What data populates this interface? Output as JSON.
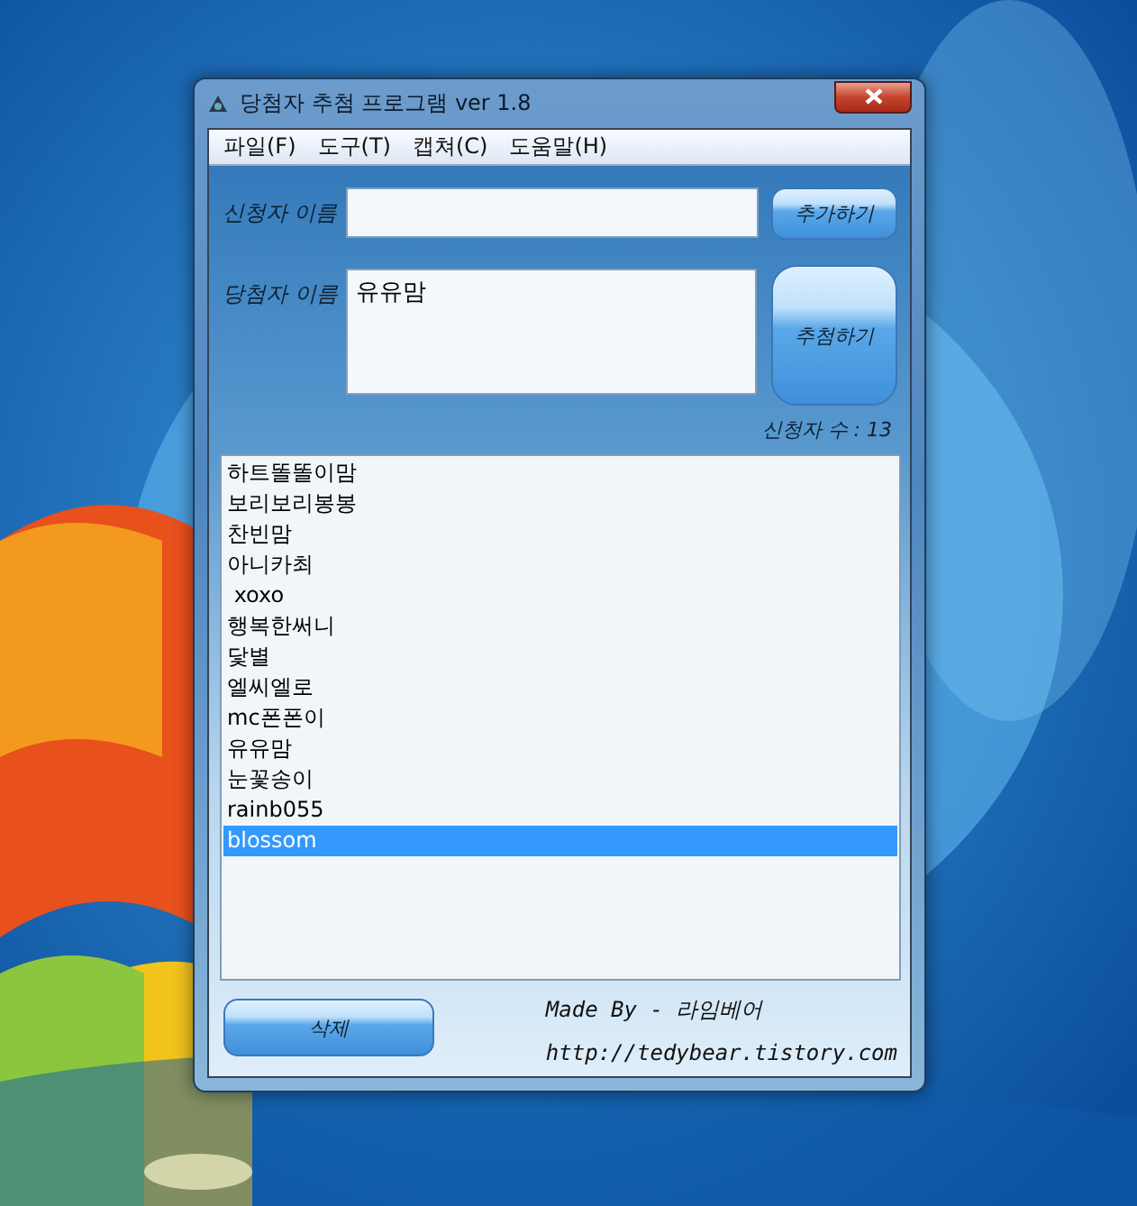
{
  "window": {
    "title": "당첨자 추첨 프로그램 ver 1.8"
  },
  "menu": [
    "파일(F)",
    "도구(T)",
    "캡쳐(C)",
    "도움말(H)"
  ],
  "applicant": {
    "label": "신청자 이름",
    "button": "추가하기"
  },
  "winner": {
    "label": "당첨자 이름",
    "value": "유유맘",
    "button": "추첨하기"
  },
  "count": "신청자 수 : 13",
  "list": [
    {
      "name": "하트똘똘이맘",
      "selected": false
    },
    {
      "name": "보리보리봉봉",
      "selected": false
    },
    {
      "name": "찬빈맘",
      "selected": false
    },
    {
      "name": "아니카최",
      "selected": false
    },
    {
      "name": " xoxo",
      "selected": false
    },
    {
      "name": "행복한써니",
      "selected": false
    },
    {
      "name": "닻별",
      "selected": false
    },
    {
      "name": "엘씨엘로",
      "selected": false
    },
    {
      "name": "mc폰폰이",
      "selected": false
    },
    {
      "name": "유유맘",
      "selected": false
    },
    {
      "name": "눈꽃송이",
      "selected": false
    },
    {
      "name": "rainb055",
      "selected": false
    },
    {
      "name": "blossom",
      "selected": true
    }
  ],
  "delete_button": "삭제",
  "credit": "Made By - 라임베어",
  "url": "http://tedybear.tistory.com"
}
